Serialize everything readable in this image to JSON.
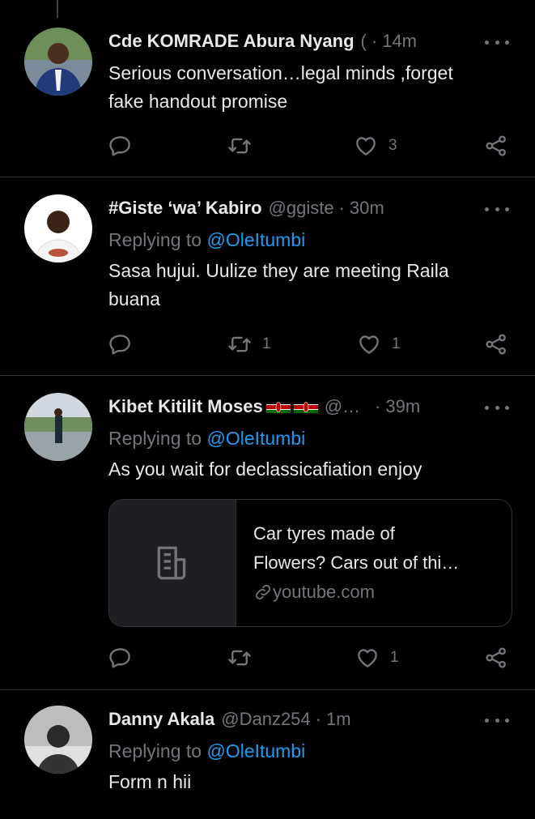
{
  "tweets": [
    {
      "name": "Cde KOMRADE Abura Nyang",
      "name_suffix": "(",
      "handle": "",
      "time": "14m",
      "lines": [
        "Serious conversation…legal minds ,forget",
        "fake handout promise"
      ],
      "replies": "",
      "retweets": "",
      "likes": "3"
    },
    {
      "name": "#Giste ‘wa’ Kabiro",
      "handle": "@ggiste",
      "time": "30m",
      "replying_prefix": "Replying to",
      "replying_to": "@OleItumbi",
      "lines": [
        "Sasa hujui. Uulize they are meeting Raila",
        "buana"
      ],
      "replies": "",
      "retweets": "1",
      "likes": "1"
    },
    {
      "name": "Kibet Kitilit Moses",
      "handle": "@…",
      "time": "39m",
      "replying_prefix": "Replying to",
      "replying_to": "@OleItumbi",
      "lines": [
        "As you wait for declassicafiation enjoy"
      ],
      "card": {
        "title_line1": "Car tyres made of",
        "title_line2": "Flowers? Cars out of thi…",
        "domain": "youtube.com"
      },
      "replies": "",
      "retweets": "",
      "likes": "1"
    },
    {
      "name": "Danny Akala",
      "handle": "@Danz254",
      "time": "1m",
      "replying_prefix": "Replying to",
      "replying_to": "@OleItumbi",
      "lines": [
        "Form n hii"
      ]
    }
  ],
  "separator": "·",
  "icons": [
    "reply-icon",
    "retweet-icon",
    "like-icon",
    "share-icon",
    "more-icon",
    "link-icon",
    "document-icon",
    "kenya-flag-icon"
  ],
  "colors": {
    "background": "#000000",
    "text": "#e7e9ea",
    "muted": "#71767b",
    "link": "#1d9bf0",
    "divider": "#2f3336"
  }
}
